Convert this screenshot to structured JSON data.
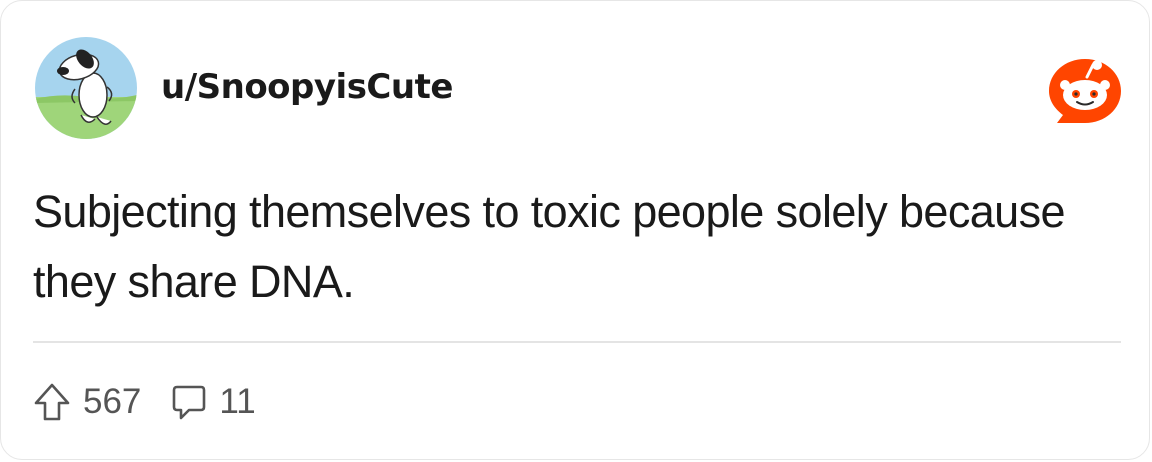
{
  "post": {
    "username": "u/SnoopyisCute",
    "text": "Subjecting themselves to toxic people solely because they share DNA.",
    "upvotes": "567",
    "comments": "11"
  },
  "icons": {
    "avatar": "snoopy-avatar",
    "brand": "reddit-logo-icon",
    "upvote": "upvote-arrow-icon",
    "comment": "comment-bubble-icon"
  },
  "colors": {
    "brand": "#ff4500",
    "text": "#1a1a1a",
    "muted": "#555555"
  }
}
